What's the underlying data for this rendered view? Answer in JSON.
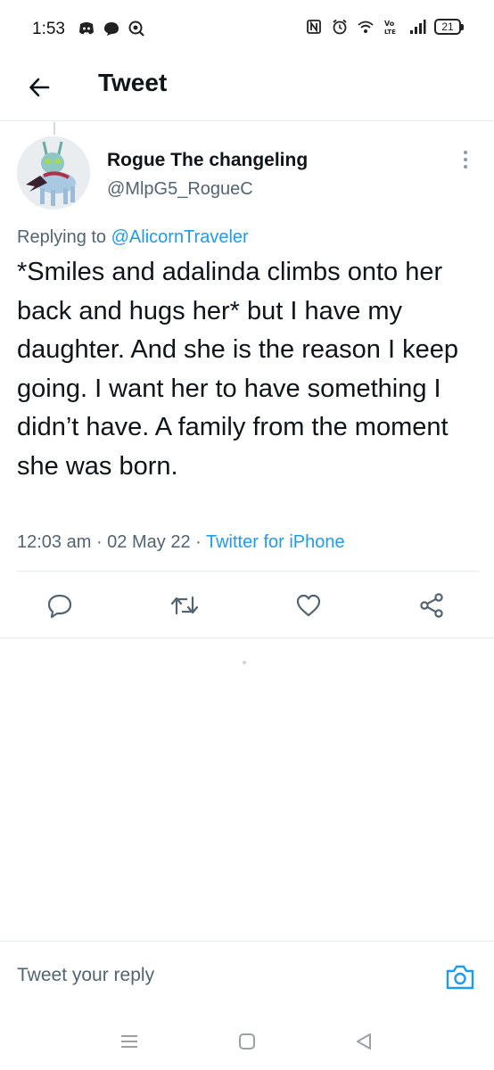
{
  "status_bar": {
    "time": "1:53",
    "battery": "21",
    "icons": [
      "discord-icon",
      "chat-bubble-icon",
      "vpn-search-icon",
      "nfc-icon",
      "alarm-icon",
      "wifi-icon",
      "volte-icon",
      "signal-icon",
      "battery-icon"
    ]
  },
  "header": {
    "title": "Tweet"
  },
  "tweet": {
    "author_name": "Rogue The changeling",
    "author_handle": "@MlpG5_RogueC",
    "replying_prefix": "Replying to",
    "replying_to": "@AlicornTraveler",
    "text": "*Smiles and adalinda climbs onto her back and hugs her* but I have my daughter. And she is the reason I keep going. I want her to have something I didn’t have. A family from the moment she was born.",
    "time": "12:03 am",
    "separator": " · ",
    "date": "02 May 22",
    "source": "Twitter for iPhone"
  },
  "actions": [
    "reply-icon",
    "retweet-icon",
    "like-icon",
    "share-icon"
  ],
  "reply_bar": {
    "placeholder": "Tweet your reply"
  },
  "colors": {
    "accent": "#1d9bf0",
    "text": "#0f1419",
    "secondary": "#536471",
    "divider": "#e6e9eb"
  }
}
